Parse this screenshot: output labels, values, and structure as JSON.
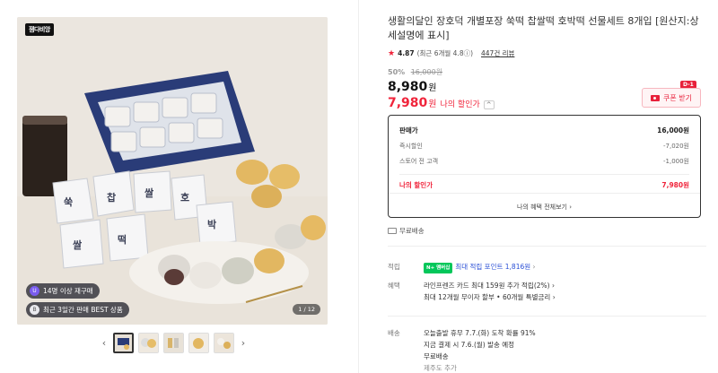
{
  "gallery": {
    "brand_badge": "잼다비앙",
    "pill_1_icon": "U",
    "pill_1": "14명 이상 재구매",
    "pill_2_icon": "B",
    "pill_2": "최근 3일간 판매 BEST 상품",
    "counter": "1 / 12",
    "prev_arrow": "‹",
    "next_arrow": "›",
    "thumbnail_count": 5
  },
  "product": {
    "title": "생활의달인 장호덕 개별포장 쑥떡 찹쌀떡 호박떡 선물세트 8개입 [원산지:상세설명에 표시]",
    "rating_star": "★",
    "rating": "4.87",
    "rating_detail": "(최근 6개월 4.8ⓘ)",
    "reviews": "447건 리뷰",
    "discount_pct": "50%",
    "original_price": "16,000원",
    "price": "8,980",
    "currency": "원",
    "my_price": "7,980",
    "my_price_label": "나의 할인가",
    "my_price_caret": "^",
    "coupon_label": "쿠폰 받기",
    "coupon_tag": "D-1"
  },
  "price_box": {
    "rows": [
      {
        "label": "판매가",
        "value": "16,000원"
      },
      {
        "label": "즉시할인",
        "value": "-7,020원"
      },
      {
        "label": "스토어 전 고객",
        "value": "-1,000원"
      }
    ],
    "mine_label": "나의 할인가",
    "mine_value": "7,980원",
    "more": "나의 혜택 전체보기 ›"
  },
  "shipping_tag": "무료배송",
  "points": {
    "key": "적립",
    "npay": "N+ 멤버십",
    "text": "최대 적립 포인트 1,816원",
    "chev": "›"
  },
  "benefits": {
    "key": "혜택",
    "line1": "라인프렌즈 카드 최대 159원 추가 적립(2%) ›",
    "line2": "최대 12개월 무이자 할부 • 60개월 특별금리 ›"
  },
  "delivery": {
    "key": "배송",
    "line1": "오늘출발 휴무   7.7.(화) 도착 확률 91%",
    "line2": "지금 결제 시 7.6.(월) 발송 예정",
    "line3": "무료배송",
    "line4": "제주도 추가"
  },
  "colors": {
    "accent_red": "#f0243b",
    "link_blue": "#2a4fd6",
    "npay_green": "#03c75a"
  }
}
